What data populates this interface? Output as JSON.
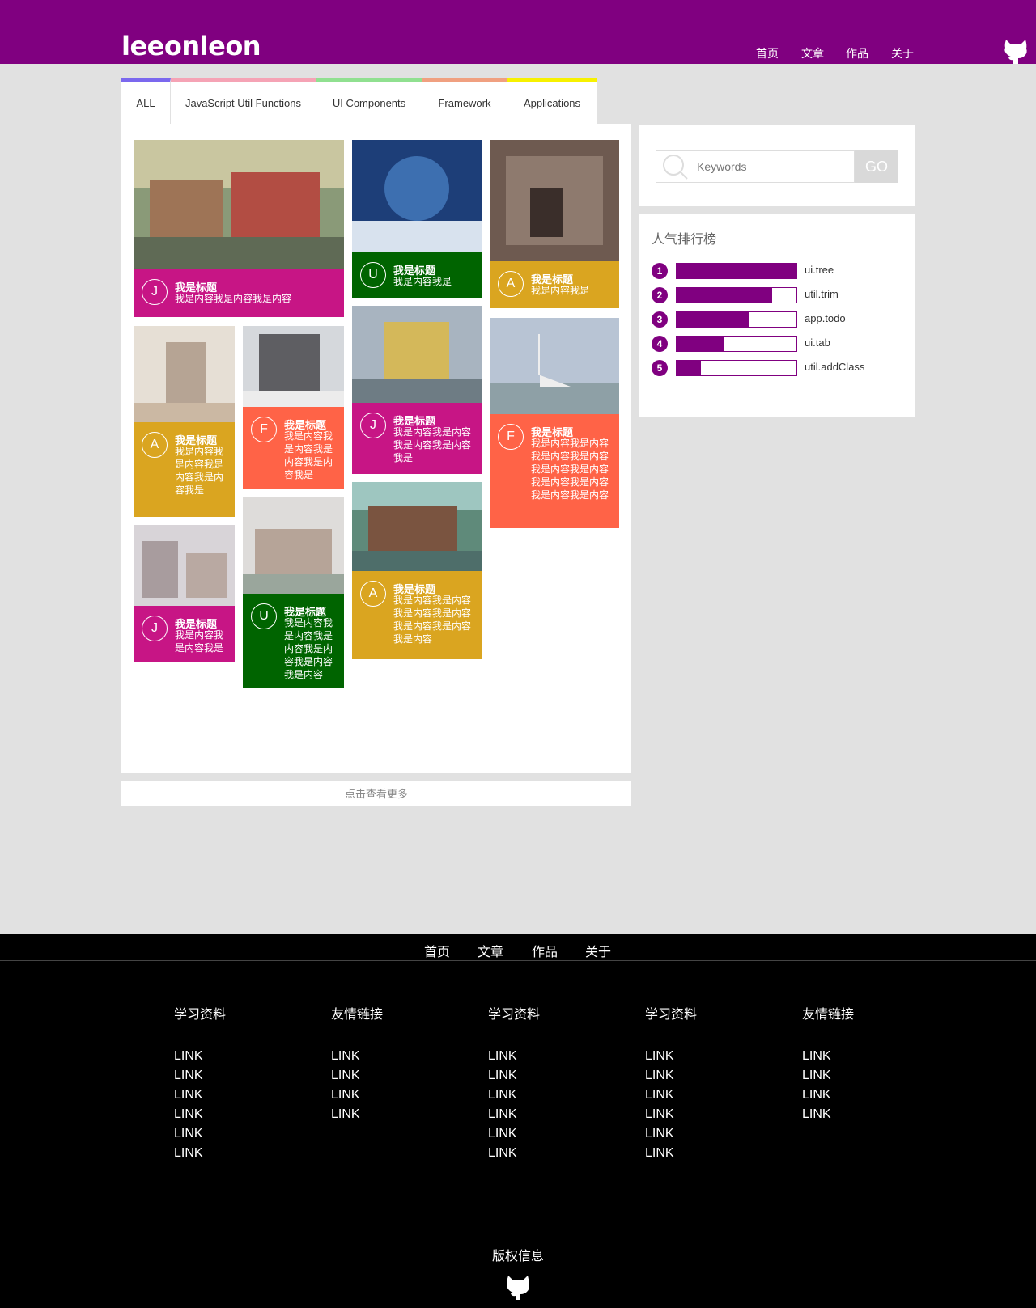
{
  "header": {
    "logo": "leeonleon",
    "nav": [
      "首页",
      "文章",
      "作品",
      "关于"
    ]
  },
  "tabs": [
    {
      "label": "ALL",
      "color": "#7b68ee"
    },
    {
      "label": "JavaScript Util Functions",
      "color": "#f5a3b5"
    },
    {
      "label": "UI Components",
      "color": "#90e090"
    },
    {
      "label": "Framework",
      "color": "#f0a080"
    },
    {
      "label": "Applications",
      "color": "#f7f100"
    }
  ],
  "colors": {
    "purple": "#800080",
    "magenta": "#c71585",
    "green": "#006400",
    "gold": "#daa520",
    "coral": "#ff6347"
  },
  "cards": [
    {
      "letter": "J",
      "title": "我是标题",
      "text": "我是内容我是内容我是内容",
      "color": "#c71585"
    },
    {
      "letter": "U",
      "title": "我是标题",
      "text": "我是内容我是",
      "color": "#006400"
    },
    {
      "letter": "A",
      "title": "我是标题",
      "text": "我是内容我是",
      "color": "#daa520"
    },
    {
      "letter": "A",
      "title": "我是标题",
      "text": "我是内容我是内容我是内容我是内容我是",
      "color": "#daa520"
    },
    {
      "letter": "F",
      "title": "我是标题",
      "text": "我是内容我是内容我是内容我是内容我是",
      "color": "#ff6347"
    },
    {
      "letter": "J",
      "title": "我是标题",
      "text": "我是内容我是内容我是内容我是内容我是",
      "color": "#c71585"
    },
    {
      "letter": "F",
      "title": "我是标题",
      "text": "我是内容我是内容我是内容我是内容我是内容我是内容我是内容我是内容我是内容我是内容",
      "color": "#ff6347"
    },
    {
      "letter": "J",
      "title": "我是标题",
      "text": "我是内容我是内容我是",
      "color": "#c71585"
    },
    {
      "letter": "U",
      "title": "我是标题",
      "text": "我是内容我是内容我是内容我是内容我是内容我是内容",
      "color": "#006400"
    },
    {
      "letter": "A",
      "title": "我是标题",
      "text": "我是内容我是内容我是内容我是内容我是内容我是内容我是内容",
      "color": "#daa520"
    }
  ],
  "load_more": "点击查看更多",
  "search": {
    "placeholder": "Keywords",
    "button": "GO"
  },
  "ranking": {
    "title": "人气排行榜",
    "items": [
      {
        "rank": "1",
        "name": "ui.tree",
        "fraction": 1.0
      },
      {
        "rank": "2",
        "name": "util.trim",
        "fraction": 0.8
      },
      {
        "rank": "3",
        "name": "app.todo",
        "fraction": 0.6
      },
      {
        "rank": "4",
        "name": "ui.tab",
        "fraction": 0.4
      },
      {
        "rank": "5",
        "name": "util.addClass",
        "fraction": 0.2
      }
    ]
  },
  "footer": {
    "nav": [
      "首页",
      "文章",
      "作品",
      "关于"
    ],
    "columns": [
      {
        "title": "学习资料",
        "links": [
          "LINK",
          "LINK",
          "LINK",
          "LINK",
          "LINK",
          "LINK"
        ]
      },
      {
        "title": "友情链接",
        "links": [
          "LINK",
          "LINK",
          "LINK",
          "LINK"
        ]
      },
      {
        "title": "学习资料",
        "links": [
          "LINK",
          "LINK",
          "LINK",
          "LINK",
          "LINK",
          "LINK"
        ]
      },
      {
        "title": "学习资料",
        "links": [
          "LINK",
          "LINK",
          "LINK",
          "LINK",
          "LINK",
          "LINK"
        ]
      },
      {
        "title": "友情链接",
        "links": [
          "LINK",
          "LINK",
          "LINK",
          "LINK"
        ]
      }
    ],
    "copyright": "版权信息"
  }
}
